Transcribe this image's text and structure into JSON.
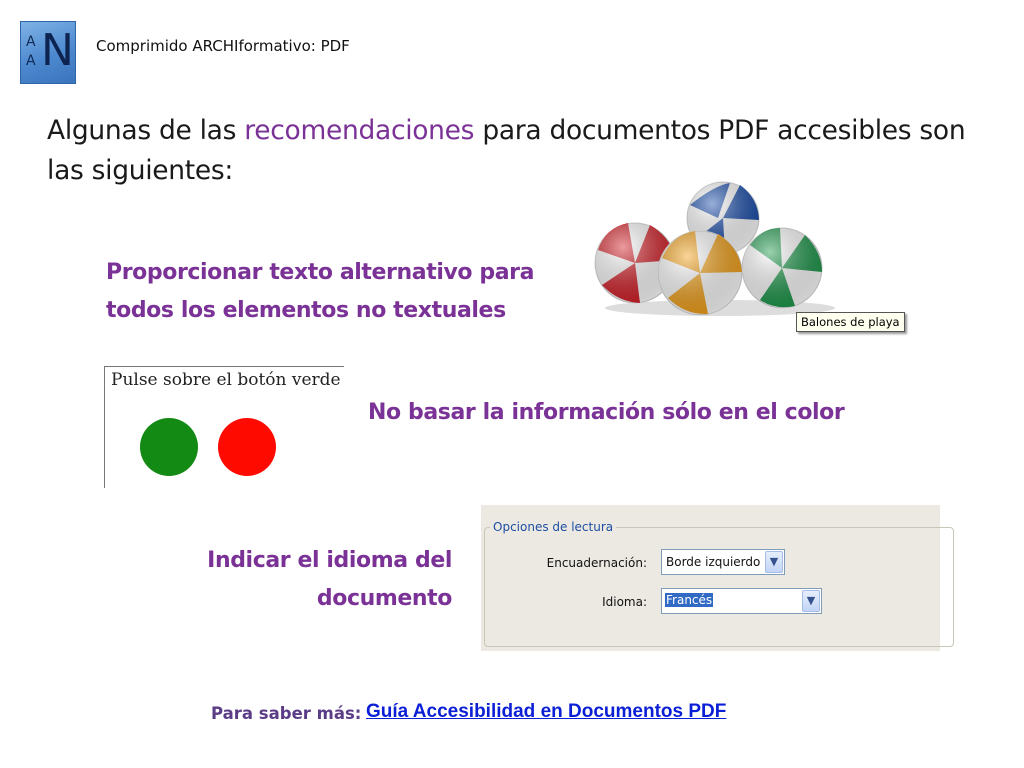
{
  "header": {
    "logo": {
      "letter_top": "A",
      "letter_bottom": "A",
      "letter_main": "N"
    },
    "title": "Comprimido ARCHIformativo: PDF"
  },
  "heading": {
    "before": "Algunas de las ",
    "highlight": "recomendaciones",
    "after": " para documentos PDF accesibles son las siguientes:"
  },
  "recommendations": [
    {
      "line1": "Proporcionar texto alternativo para",
      "line2": "todos los elementos no textuales"
    },
    {
      "line1": "No basar la información sólo en el color"
    },
    {
      "line1": "Indicar el idioma del",
      "line2": "documento"
    }
  ],
  "beach_balls": {
    "tooltip": "Balones de playa"
  },
  "color_example": {
    "text": "Pulse sobre el botón verde"
  },
  "dialog": {
    "legend": "Opciones de lectura",
    "binding_label": "Encuadernación:",
    "binding_value": "Borde izquierdo",
    "language_label": "Idioma:",
    "language_value": "Francés"
  },
  "footer": {
    "label": "Para saber más:",
    "link": "Guía Accesibilidad en Documentos PDF"
  },
  "colors": {
    "accent_purple": "#7b3296",
    "link_blue": "#0b1fd6",
    "green_button": "#138a13",
    "red_button": "#ff0a00"
  }
}
